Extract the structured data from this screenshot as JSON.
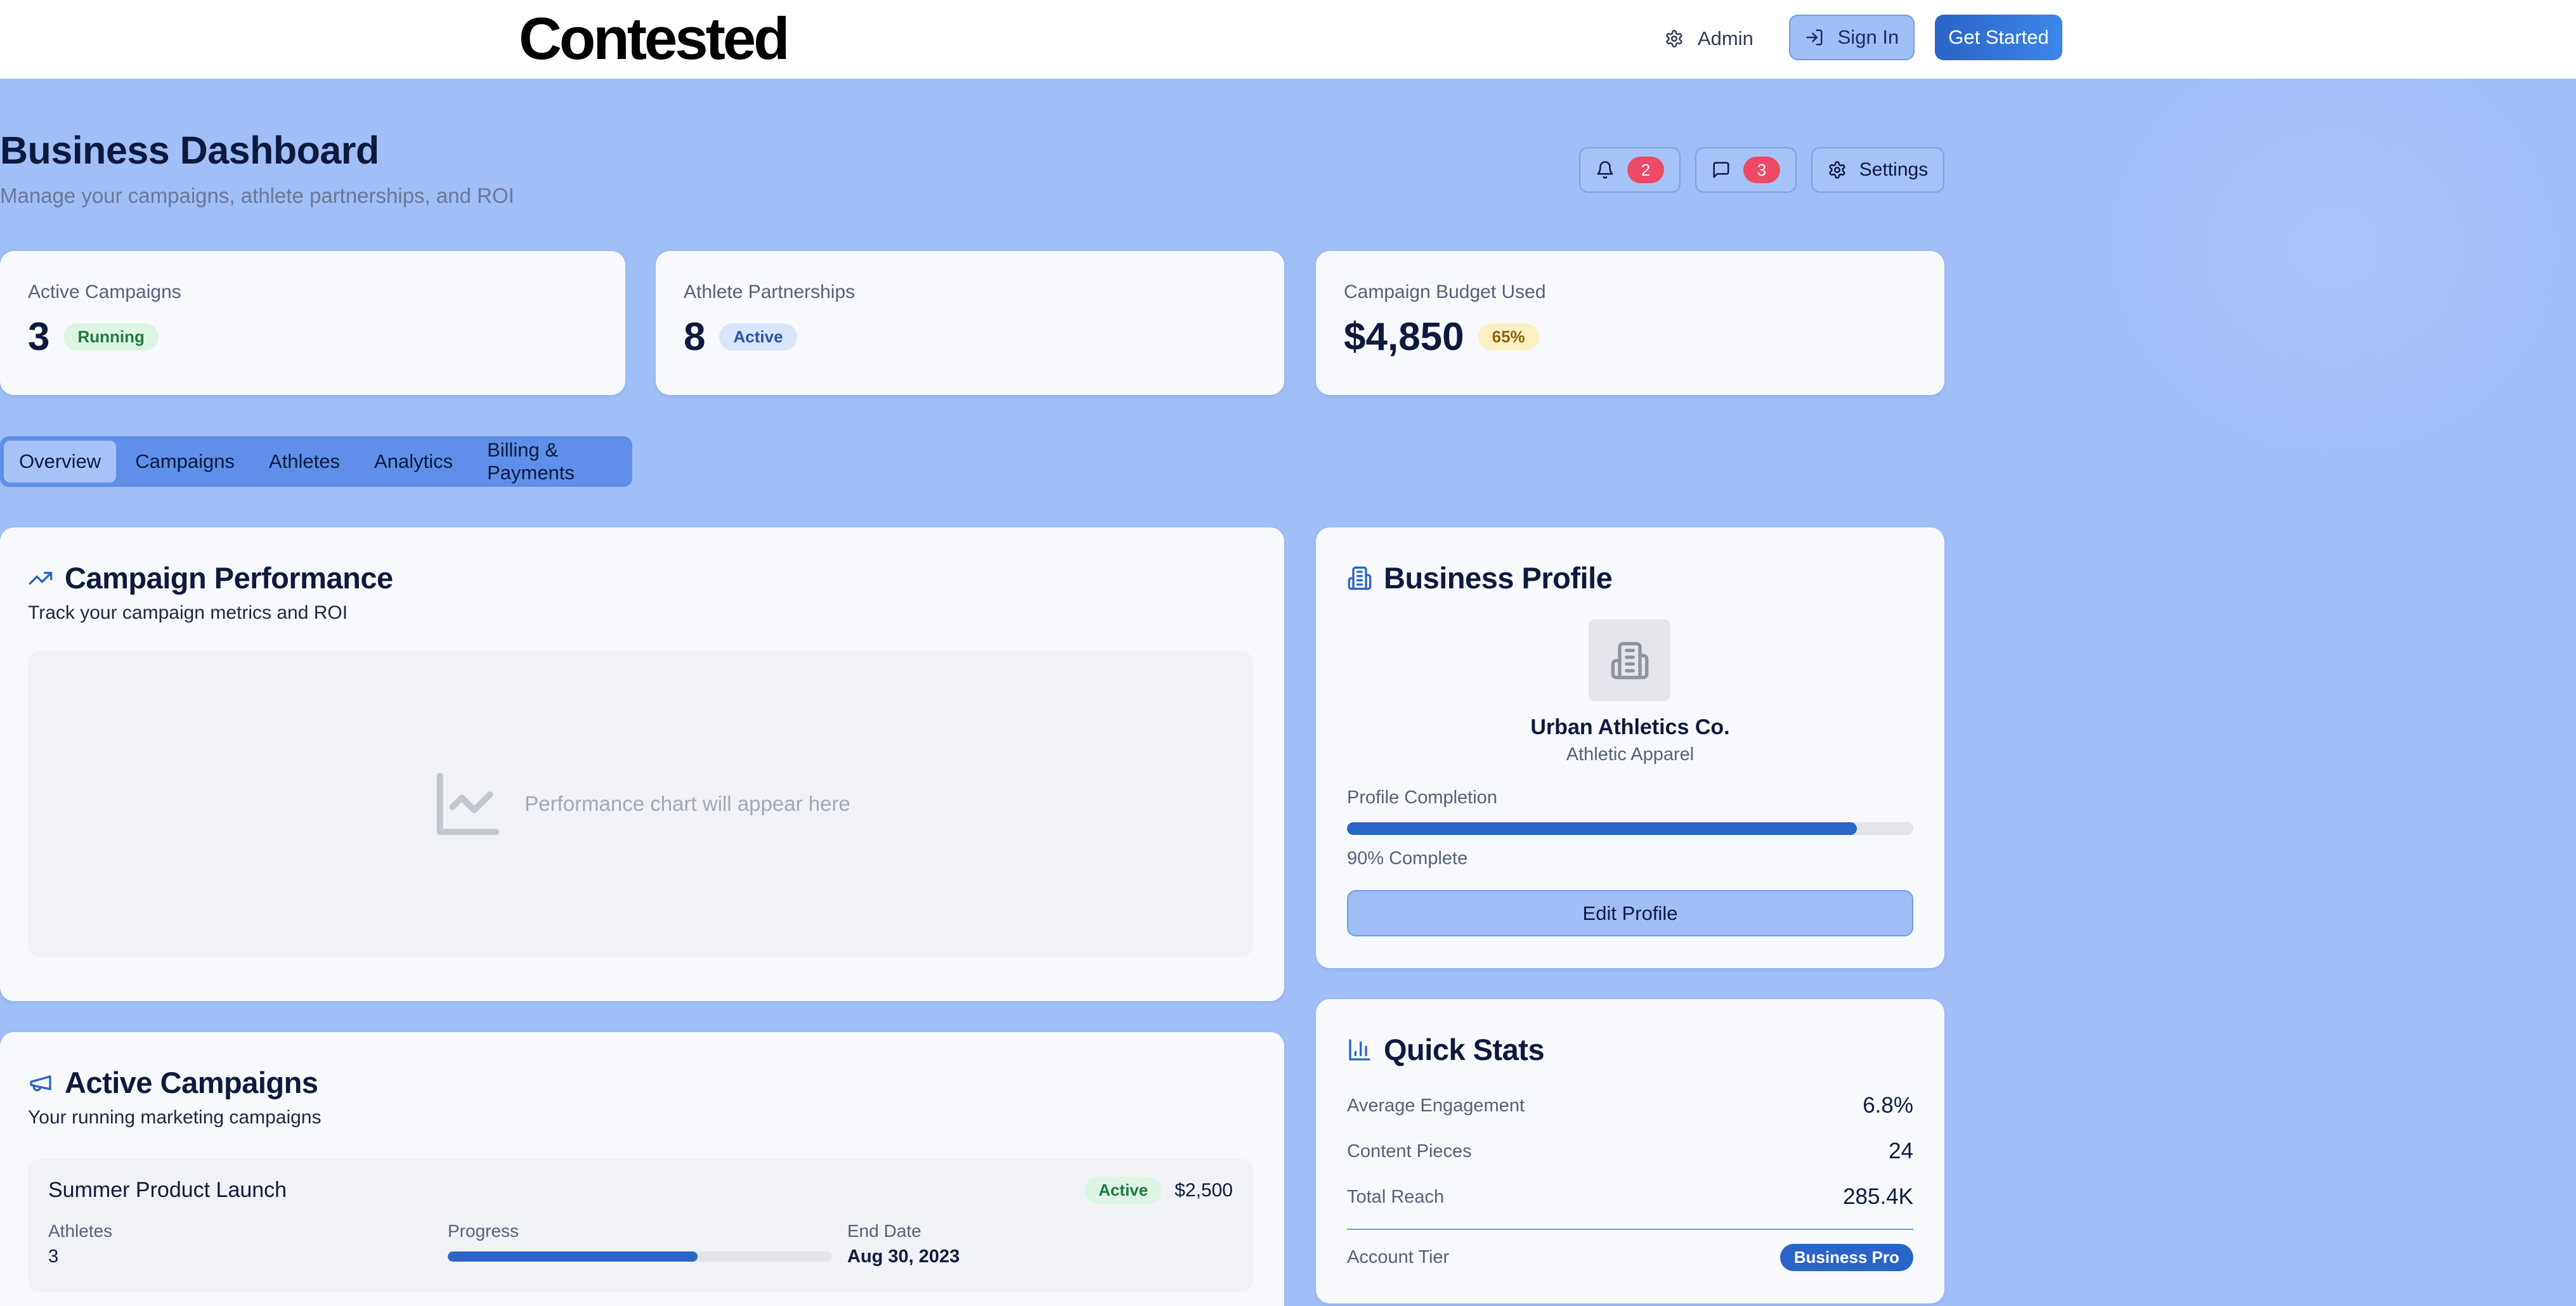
{
  "header": {
    "logo": "Contested",
    "admin_label": "Admin",
    "signin_label": "Sign In",
    "get_started_label": "Get Started"
  },
  "page": {
    "title": "Business Dashboard",
    "subtitle": "Manage your campaigns, athlete partnerships, and ROI",
    "notifications_count": "2",
    "messages_count": "3",
    "settings_label": "Settings"
  },
  "stats": [
    {
      "label": "Active Campaigns",
      "value": "3",
      "badge": "Running"
    },
    {
      "label": "Athlete Partnerships",
      "value": "8",
      "badge": "Active"
    },
    {
      "label": "Campaign Budget Used",
      "value": "$4,850",
      "badge": "65%"
    }
  ],
  "tabs": [
    {
      "label": "Overview",
      "active": true
    },
    {
      "label": "Campaigns",
      "active": false
    },
    {
      "label": "Athletes",
      "active": false
    },
    {
      "label": "Analytics",
      "active": false
    },
    {
      "label": "Billing & Payments",
      "active": false
    }
  ],
  "performance": {
    "title": "Campaign Performance",
    "subtitle": "Track your campaign metrics and ROI",
    "placeholder": "Performance chart will appear here"
  },
  "active_campaigns": {
    "title": "Active Campaigns",
    "subtitle": "Your running marketing campaigns",
    "items": [
      {
        "name": "Summer Product Launch",
        "status": "Active",
        "budget": "$2,500",
        "athletes_label": "Athletes",
        "athletes": "3",
        "progress_label": "Progress",
        "progress": 0.65,
        "end_date_label": "End Date",
        "end_date": "Aug 30, 2023"
      }
    ]
  },
  "profile": {
    "title": "Business Profile",
    "name": "Urban Athletics Co.",
    "category": "Athletic Apparel",
    "completion_label": "Profile Completion",
    "completion": 0.9,
    "completion_text": "90% Complete",
    "edit_label": "Edit Profile"
  },
  "quick_stats": {
    "title": "Quick Stats",
    "rows": [
      {
        "label": "Average Engagement",
        "value": "6.8%"
      },
      {
        "label": "Content Pieces",
        "value": "24"
      },
      {
        "label": "Total Reach",
        "value": "285.4K"
      }
    ],
    "tier_label": "Account Tier",
    "tier_value": "Business Pro"
  },
  "colors": {
    "background": "#a0bff7",
    "primary": "#2a64c6",
    "badge_red": "#ec4a67",
    "card": "#f8f9fc"
  }
}
